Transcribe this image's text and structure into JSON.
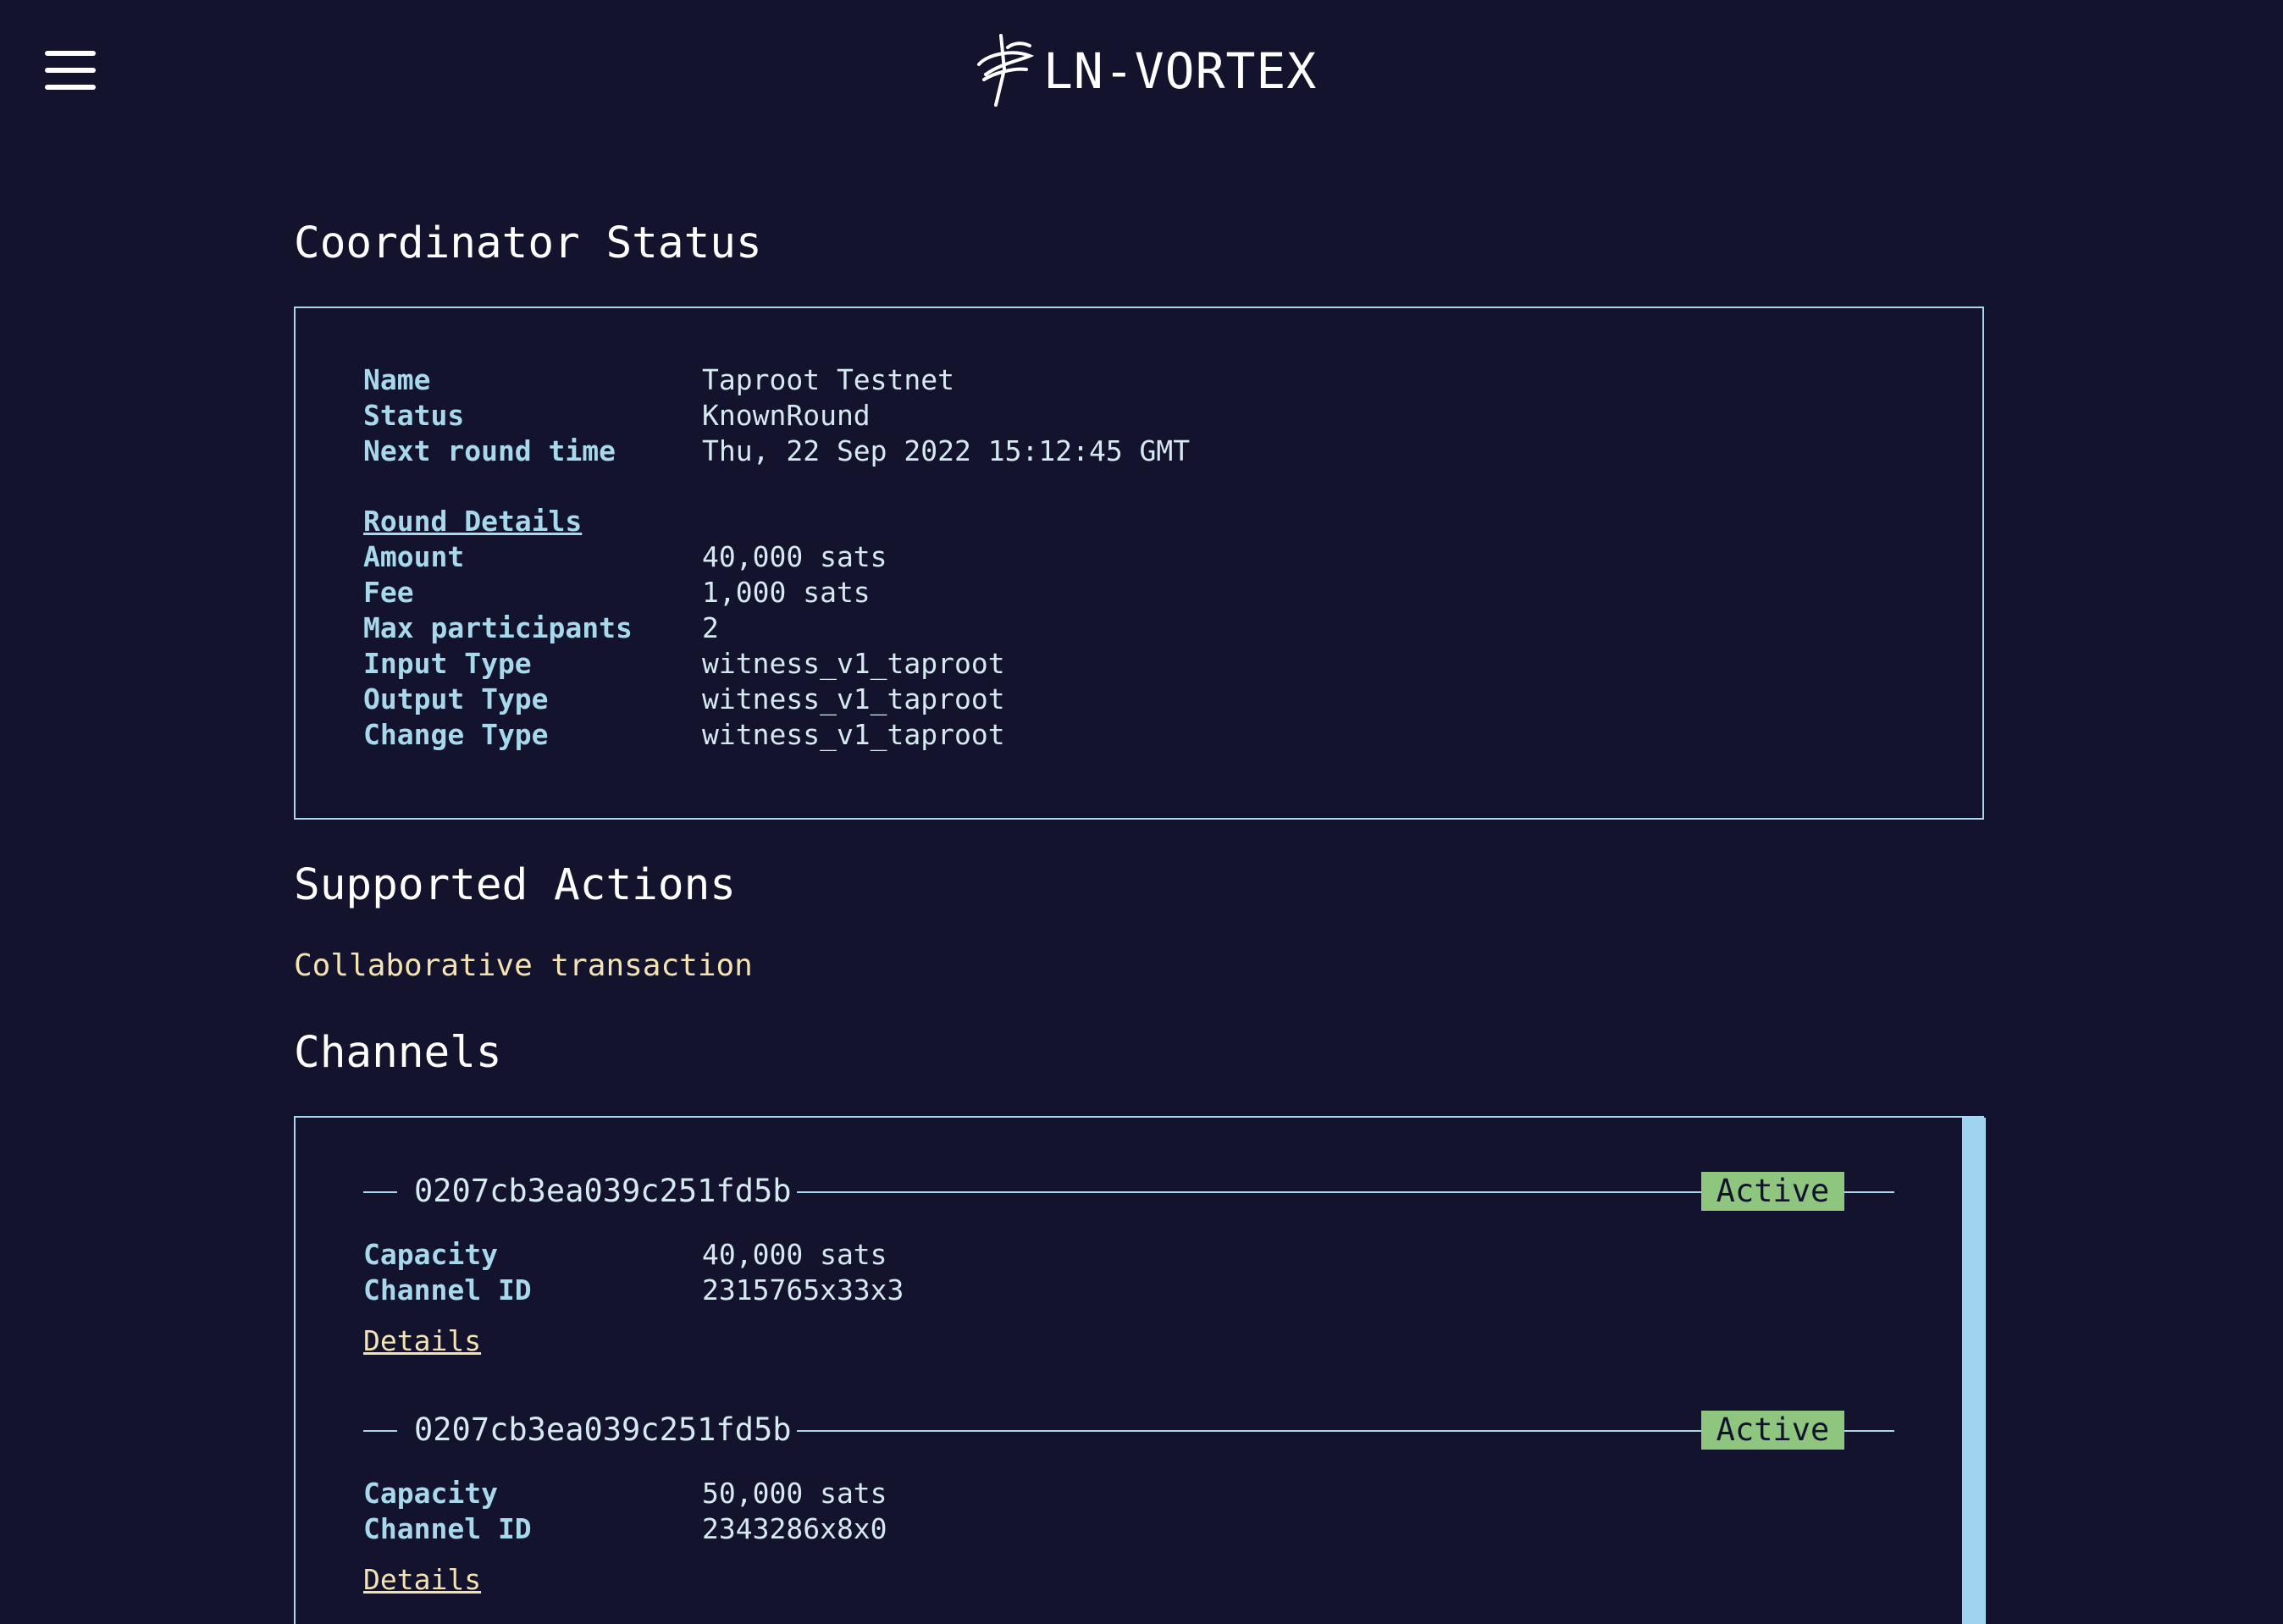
{
  "header": {
    "brand_text": "LN-VORTEX",
    "menu_icon": "hamburger-menu-icon",
    "logo_icon": "vortex-logo-icon"
  },
  "coordinator": {
    "heading": "Coordinator Status",
    "name_label": "Name",
    "name_value": "Taproot Testnet",
    "status_label": "Status",
    "status_value": "KnownRound",
    "next_round_label": "Next round time",
    "next_round_value": "Thu, 22 Sep 2022 15:12:45 GMT",
    "round_details_link": "Round Details",
    "amount_label": "Amount",
    "amount_value": "40,000 sats",
    "fee_label": "Fee",
    "fee_value": "1,000 sats",
    "max_participants_label": "Max participants",
    "max_participants_value": "2",
    "input_type_label": "Input Type",
    "input_type_value": "witness_v1_taproot",
    "output_type_label": "Output Type",
    "output_type_value": "witness_v1_taproot",
    "change_type_label": "Change Type",
    "change_type_value": "witness_v1_taproot"
  },
  "actions": {
    "heading": "Supported Actions",
    "items": [
      "Collaborative transaction"
    ]
  },
  "channels": {
    "heading": "Channels",
    "capacity_label": "Capacity",
    "channel_id_label": "Channel ID",
    "details_label": "Details",
    "items": [
      {
        "node_id": "0207cb3ea039c251fd5b",
        "status": "Active",
        "capacity": "40,000 sats",
        "channel_id": "2315765x33x3"
      },
      {
        "node_id": "0207cb3ea039c251fd5b",
        "status": "Active",
        "capacity": "50,000 sats",
        "channel_id": "2343286x8x0"
      }
    ]
  },
  "colors": {
    "background": "#13132d",
    "accent": "#a8d8ec",
    "link": "#f4e3b2",
    "active_badge": "#8fc67f"
  }
}
